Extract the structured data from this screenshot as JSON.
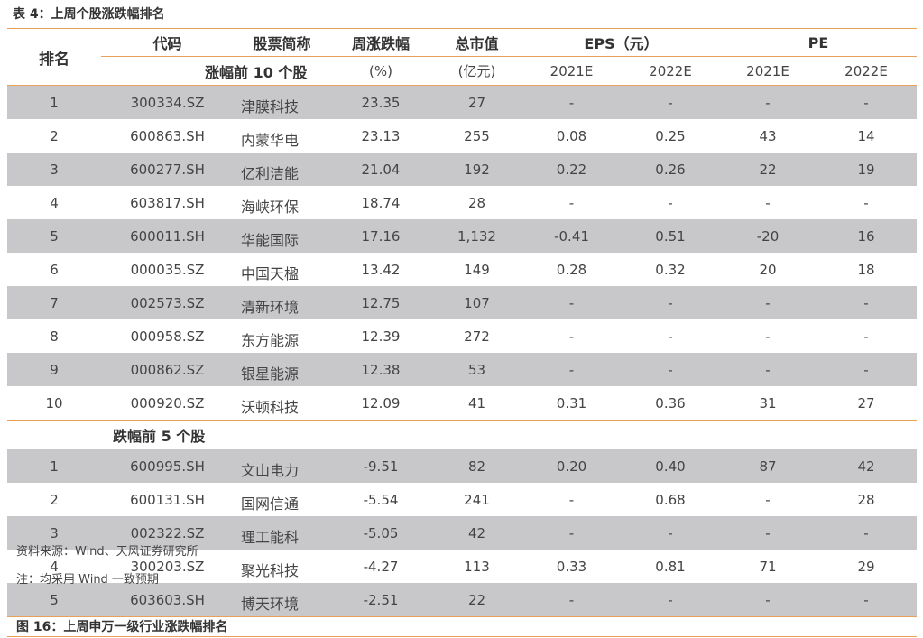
{
  "title": "表 4：上周个股涨跌幅排名",
  "header": {
    "rank": "排名",
    "code": "代码",
    "name": "股票简称",
    "change": "周涨跌幅",
    "mcap": "总市值",
    "eps": "EPS（元）",
    "pe": "PE",
    "change_unit": "(%)",
    "mcap_unit": "(亿元)",
    "eps_2021": "2021E",
    "eps_2022": "2022E",
    "pe_2021": "2021E",
    "pe_2022": "2022E"
  },
  "gainers_label": "涨幅前 10 个股",
  "losers_label": "跌幅前 5 个股",
  "gainers": [
    {
      "rank": "1",
      "code": "300334.SZ",
      "name": "津膜科技",
      "change": "23.35",
      "mcap": "27",
      "eps21": "-",
      "eps22": "-",
      "pe21": "-",
      "pe22": "-"
    },
    {
      "rank": "2",
      "code": "600863.SH",
      "name": "内蒙华电",
      "change": "23.13",
      "mcap": "255",
      "eps21": "0.08",
      "eps22": "0.25",
      "pe21": "43",
      "pe22": "14"
    },
    {
      "rank": "3",
      "code": "600277.SH",
      "name": "亿利洁能",
      "change": "21.04",
      "mcap": "192",
      "eps21": "0.22",
      "eps22": "0.26",
      "pe21": "22",
      "pe22": "19"
    },
    {
      "rank": "4",
      "code": "603817.SH",
      "name": "海峡环保",
      "change": "18.74",
      "mcap": "28",
      "eps21": "-",
      "eps22": "-",
      "pe21": "-",
      "pe22": "-"
    },
    {
      "rank": "5",
      "code": "600011.SH",
      "name": "华能国际",
      "change": "17.16",
      "mcap": "1,132",
      "eps21": "-0.41",
      "eps22": "0.51",
      "pe21": "-20",
      "pe22": "16"
    },
    {
      "rank": "6",
      "code": "000035.SZ",
      "name": "中国天楹",
      "change": "13.42",
      "mcap": "149",
      "eps21": "0.28",
      "eps22": "0.32",
      "pe21": "20",
      "pe22": "18"
    },
    {
      "rank": "7",
      "code": "002573.SZ",
      "name": "清新环境",
      "change": "12.75",
      "mcap": "107",
      "eps21": "-",
      "eps22": "-",
      "pe21": "-",
      "pe22": "-"
    },
    {
      "rank": "8",
      "code": "000958.SZ",
      "name": "东方能源",
      "change": "12.39",
      "mcap": "272",
      "eps21": "-",
      "eps22": "-",
      "pe21": "-",
      "pe22": "-"
    },
    {
      "rank": "9",
      "code": "000862.SZ",
      "name": "银星能源",
      "change": "12.38",
      "mcap": "53",
      "eps21": "-",
      "eps22": "-",
      "pe21": "-",
      "pe22": "-"
    },
    {
      "rank": "10",
      "code": "000920.SZ",
      "name": "沃顿科技",
      "change": "12.09",
      "mcap": "41",
      "eps21": "0.31",
      "eps22": "0.36",
      "pe21": "31",
      "pe22": "27"
    }
  ],
  "losers": [
    {
      "rank": "1",
      "code": "600995.SH",
      "name": "文山电力",
      "change": "-9.51",
      "mcap": "82",
      "eps21": "0.20",
      "eps22": "0.40",
      "pe21": "87",
      "pe22": "42"
    },
    {
      "rank": "2",
      "code": "600131.SH",
      "name": "国网信通",
      "change": "-5.54",
      "mcap": "241",
      "eps21": "-",
      "eps22": "0.68",
      "pe21": "-",
      "pe22": "28"
    },
    {
      "rank": "3",
      "code": "002322.SZ",
      "name": "理工能科",
      "change": "-5.05",
      "mcap": "42",
      "eps21": "-",
      "eps22": "-",
      "pe21": "-",
      "pe22": "-"
    },
    {
      "rank": "4",
      "code": "300203.SZ",
      "name": "聚光科技",
      "change": "-4.27",
      "mcap": "113",
      "eps21": "0.33",
      "eps22": "0.81",
      "pe21": "71",
      "pe22": "29"
    },
    {
      "rank": "5",
      "code": "603603.SH",
      "name": "博天环境",
      "change": "-2.51",
      "mcap": "22",
      "eps21": "-",
      "eps22": "-",
      "pe21": "-",
      "pe22": "-"
    }
  ],
  "source": "资料来源：Wind、天风证券研究所",
  "note": "注：均采用 Wind 一致预期",
  "next_figure_title": "图 16：上周申万一级行业涨跌幅排名",
  "colors": {
    "accent_line": "#e8a15c",
    "shade_row": "#c8c8cb"
  }
}
